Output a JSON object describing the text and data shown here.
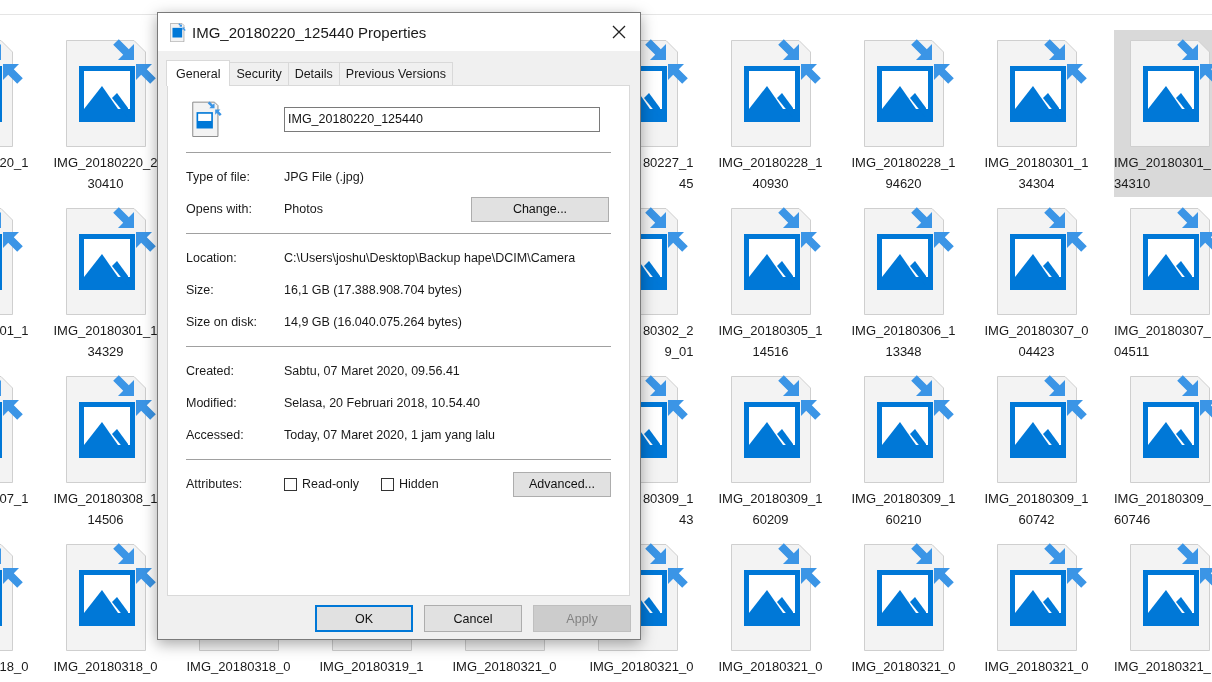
{
  "explorer": {
    "rows": [
      {
        "items": [
          {
            "label": [
              "20_1"
            ],
            "selected": false
          },
          {
            "label": [
              "IMG_20180220_2",
              "30410"
            ],
            "selected": false
          },
          {
            "label": [
              "80227_1",
              "45"
            ],
            "selected": false
          },
          {
            "label": [
              "IMG_20180228_1",
              "40930"
            ],
            "selected": false
          },
          {
            "label": [
              "IMG_20180228_1",
              "94620"
            ],
            "selected": false
          },
          {
            "label": [
              "IMG_20180301_1",
              "34304"
            ],
            "selected": false
          },
          {
            "label": [
              "IMG_20180301_",
              "34310"
            ],
            "selected": true
          }
        ]
      },
      {
        "items": [
          {
            "label": [
              "01_1"
            ],
            "selected": false
          },
          {
            "label": [
              "IMG_20180301_1",
              "34329"
            ],
            "selected": false
          },
          {
            "label": [
              "80302_2",
              "9_01"
            ],
            "selected": false
          },
          {
            "label": [
              "IMG_20180305_1",
              "14516"
            ],
            "selected": false
          },
          {
            "label": [
              "IMG_20180306_1",
              "13348"
            ],
            "selected": false
          },
          {
            "label": [
              "IMG_20180307_0",
              "04423"
            ],
            "selected": false
          },
          {
            "label": [
              "IMG_20180307_",
              "04511"
            ],
            "selected": false
          }
        ]
      },
      {
        "items": [
          {
            "label": [
              "07_1"
            ],
            "selected": false
          },
          {
            "label": [
              "IMG_20180308_1",
              "14506"
            ],
            "selected": false
          },
          {
            "label": [
              "80309_1",
              "43"
            ],
            "selected": false
          },
          {
            "label": [
              "IMG_20180309_1",
              "60209"
            ],
            "selected": false
          },
          {
            "label": [
              "IMG_20180309_1",
              "60210"
            ],
            "selected": false
          },
          {
            "label": [
              "IMG_20180309_1",
              "60742"
            ],
            "selected": false
          },
          {
            "label": [
              "IMG_20180309_",
              "60746"
            ],
            "selected": false
          }
        ]
      },
      {
        "items": [
          {
            "label": [
              "18_0"
            ],
            "selected": false
          },
          {
            "label": [
              "IMG_20180318_0"
            ],
            "selected": false
          },
          {
            "label": [
              "IMG_20180318_0"
            ],
            "selected": false
          },
          {
            "label": [
              "IMG_20180319_1"
            ],
            "selected": false
          },
          {
            "label": [
              "IMG_20180321_0"
            ],
            "selected": false
          },
          {
            "label": [
              "IMG_20180321_0"
            ],
            "selected": false
          },
          {
            "label": [
              "IMG_20180321_0"
            ],
            "selected": false
          },
          {
            "label": [
              "IMG_20180321_0"
            ],
            "selected": false
          },
          {
            "label": [
              "IMG_20180321_0"
            ],
            "selected": false
          },
          {
            "label": [
              "IMG_20180321_"
            ],
            "selected": false
          }
        ]
      }
    ]
  },
  "dialog": {
    "title": "IMG_20180220_125440 Properties",
    "tabs": [
      {
        "label": "General",
        "selected": true
      },
      {
        "label": "Security",
        "selected": false
      },
      {
        "label": "Details",
        "selected": false
      },
      {
        "label": "Previous Versions",
        "selected": false
      }
    ],
    "file_name": "IMG_20180220_125440",
    "sections": [
      {
        "rows": [
          {
            "label": "Type of file:",
            "value": "JPG File (.jpg)"
          },
          {
            "label": "Opens with:",
            "value": "Photos",
            "button": "Change..."
          }
        ]
      },
      {
        "rows": [
          {
            "label": "Location:",
            "value": "C:\\Users\\joshu\\Desktop\\Backup hape\\DCIM\\Camera"
          },
          {
            "label": "Size:",
            "value": "16,1 GB (17.388.908.704 bytes)"
          },
          {
            "label": "Size on disk:",
            "value": "14,9 GB (16.040.075.264 bytes)"
          }
        ]
      },
      {
        "rows": [
          {
            "label": "Created:",
            "value": "Sabtu, 07 Maret 2020, 09.56.41"
          },
          {
            "label": "Modified:",
            "value": "Selasa, 20 Februari 2018, 10.54.40"
          },
          {
            "label": "Accessed:",
            "value": "Today, 07 Maret 2020, 1 jam yang lalu"
          }
        ]
      }
    ],
    "attributes": {
      "label": "Attributes:",
      "checkboxes": [
        {
          "label": "Read-only",
          "checked": false
        },
        {
          "label": "Hidden",
          "checked": false
        }
      ],
      "button": "Advanced..."
    },
    "buttons": [
      {
        "label": "OK",
        "focused": true,
        "disabled": false
      },
      {
        "label": "Cancel",
        "focused": false,
        "disabled": false
      },
      {
        "label": "Apply",
        "focused": false,
        "disabled": true
      }
    ]
  }
}
